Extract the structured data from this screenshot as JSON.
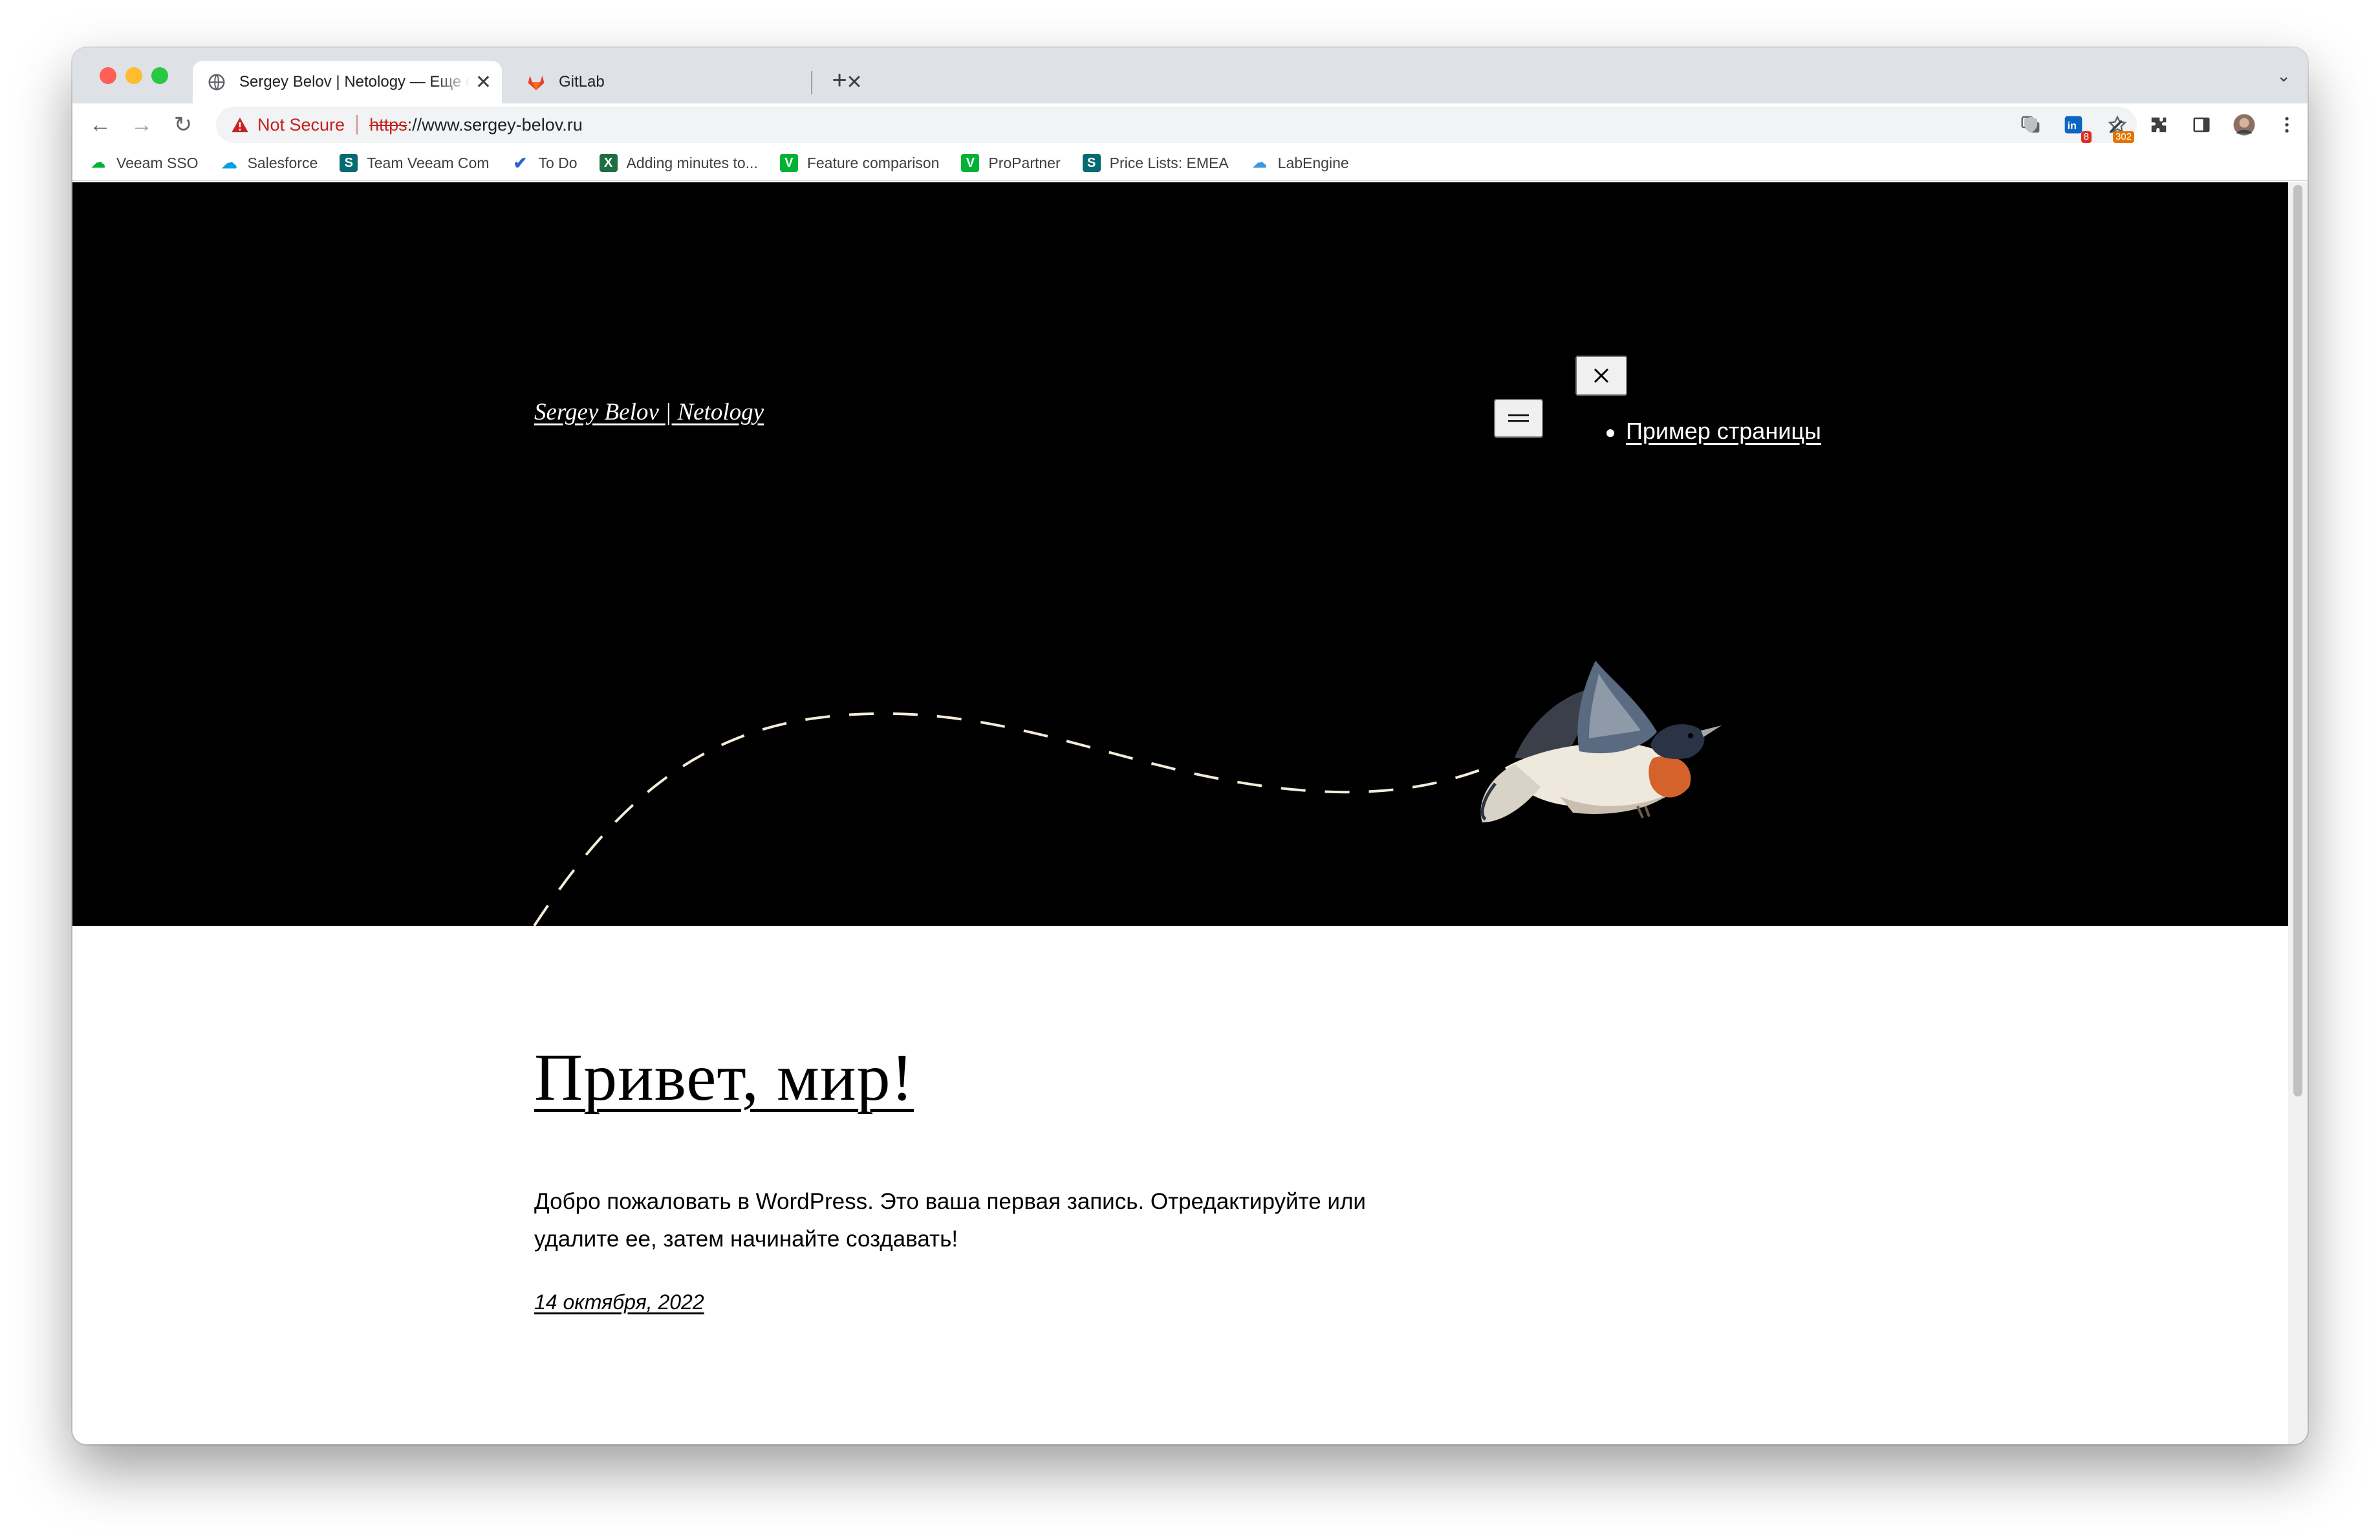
{
  "browser": {
    "tabs": [
      {
        "title": "Sergey Belov | Netology — Еще один сайт на WordPress",
        "favicon": "globe-icon",
        "active": true
      },
      {
        "title": "GitLab",
        "favicon": "gitlab-icon",
        "active": false
      }
    ],
    "tab_close": "✕",
    "new_tab": "+",
    "tab_list": "⌄",
    "nav": {
      "back": "←",
      "forward": "→",
      "reload": "↻"
    },
    "address": {
      "security_label": "Not Secure",
      "scheme": "https",
      "rest": "://www.sergey-belov.ru"
    },
    "extension_badges": {
      "ext1": "8",
      "ext2": "302"
    },
    "bookmarks": [
      {
        "label": "Veeam SSO",
        "icon": "veeam-sso-icon",
        "color": "#00b336"
      },
      {
        "label": "Salesforce",
        "icon": "salesforce-cloud-icon",
        "color": "#00a1e0"
      },
      {
        "label": "Team Veeam Com",
        "icon": "sharepoint-icon",
        "color": "#036c70"
      },
      {
        "label": "To Do",
        "icon": "todo-check-icon",
        "color": "#2564cf"
      },
      {
        "label": "Adding minutes to...",
        "icon": "excel-icon",
        "color": "#1d6f42"
      },
      {
        "label": "Feature comparison",
        "icon": "veeam-v-icon",
        "color": "#00b336"
      },
      {
        "label": "ProPartner",
        "icon": "veeam-v-icon",
        "color": "#00b336"
      },
      {
        "label": "Price Lists: EMEA",
        "icon": "sharepoint-icon",
        "color": "#036c70"
      },
      {
        "label": "LabEngine",
        "icon": "labengine-icon",
        "color": "#3b9ae1"
      }
    ]
  },
  "page": {
    "site_title": "Sergey Belov | Netology",
    "nav_items": [
      "Пример страницы"
    ],
    "post": {
      "title": "Привет, мир!",
      "body": "Добро пожаловать в WordPress. Это ваша первая запись. Отредактируйте или удалите ее, затем начинайте создавать!",
      "date": "14 октября, 2022"
    }
  },
  "colors": {
    "hero_bg": "#000000",
    "not_secure": "#c5221f",
    "tabstrip": "#dee1e6"
  }
}
